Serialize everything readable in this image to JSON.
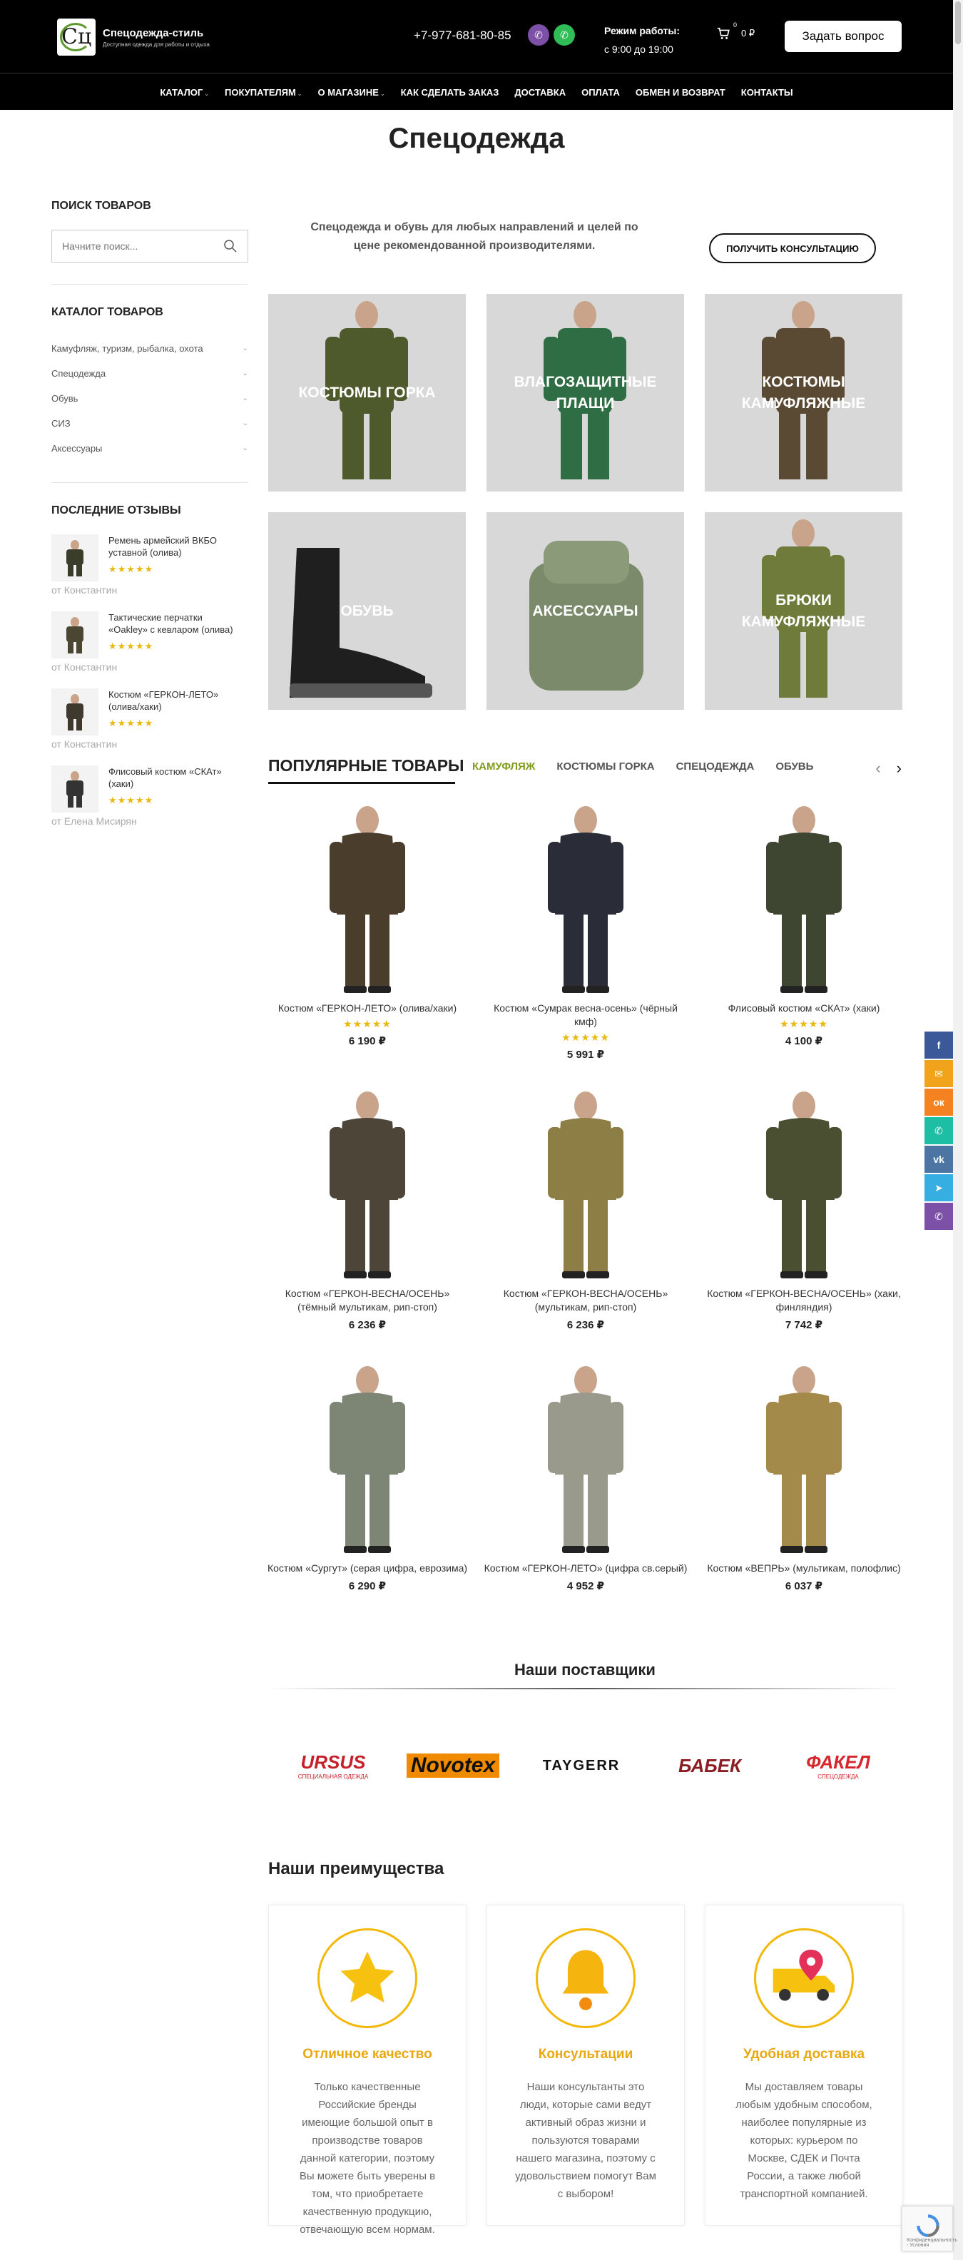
{
  "header": {
    "logo_title": "Спецодежда-стиль",
    "logo_subtitle": "Доступная одежда для работы и отдыха",
    "logo_mark": "Сц",
    "phone": "+7-977-681-80-85",
    "hours_label": "Режим работы:",
    "hours_value": "с 9:00 до 19:00",
    "cart_total": "0 ₽",
    "cart_count": "0",
    "ask_button": "Задать вопрос"
  },
  "nav": [
    {
      "label": "КАТАЛОГ",
      "caret": true
    },
    {
      "label": "ПОКУПАТЕЛЯМ",
      "caret": true
    },
    {
      "label": "О МАГАЗИНЕ",
      "caret": true
    },
    {
      "label": "КАК СДЕЛАТЬ ЗАКАЗ",
      "caret": false
    },
    {
      "label": "ДОСТАВКА",
      "caret": false
    },
    {
      "label": "ОПЛАТА",
      "caret": false
    },
    {
      "label": "ОБМЕН И ВОЗВРАТ",
      "caret": false
    },
    {
      "label": "КОНТАКТЫ",
      "caret": false
    }
  ],
  "page_title": "Спецодежда",
  "sidebar": {
    "search_heading": "ПОИСК ТОВАРОВ",
    "search_placeholder": "Начните поиск...",
    "catalog_heading": "КАТАЛОГ ТОВАРОВ",
    "categories": [
      "Камуфляж, туризм, рыбалка, охота",
      "Спецодежда",
      "Обувь",
      "СИЗ",
      "Аксессуары"
    ],
    "reviews_heading": "ПОСЛЕДНИЕ ОТЗЫВЫ",
    "reviews": [
      {
        "product": "Ремень армейский ВКБО уставной (олива)",
        "author": "от Константин",
        "stars": "★★★★★"
      },
      {
        "product": "Тактические перчатки «Oakley» с кевларом (олива)",
        "author": "от Константин",
        "stars": "★★★★★"
      },
      {
        "product": "Костюм «ГЕРКОН-ЛЕТО» (олива/хаки)",
        "author": "от Константин",
        "stars": "★★★★★"
      },
      {
        "product": "Флисовый костюм «СКАт» (хаки)",
        "author": "от Елена Мисирян",
        "stars": "★★★★★"
      }
    ]
  },
  "intro": {
    "text": "Спецодежда и обувь для любых направлений и целей по цене рекомендованной производителями.",
    "consult_button": "ПОЛУЧИТЬ КОНСУЛЬТАЦИЮ"
  },
  "categories": [
    {
      "label": "КОСТЮМЫ ГОРКА",
      "color": "#4f5a2c"
    },
    {
      "label": "ВЛАГОЗАЩИТНЫЕ ПЛАЩИ",
      "color": "#2f6d45"
    },
    {
      "label": "КОСТЮМЫ КАМУФЛЯЖНЫЕ",
      "color": "#5b4a33"
    },
    {
      "label": "ОБУВЬ",
      "color": "#1f1f1f"
    },
    {
      "label": "АКСЕССУАРЫ",
      "color": "#7a8a6a"
    },
    {
      "label": "БРЮКИ КАМУФЛЯЖНЫЕ",
      "color": "#6f7b3a"
    }
  ],
  "popular": {
    "title": "ПОПУЛЯРНЫЕ ТОВАРЫ",
    "tabs": [
      "КАМУФЛЯЖ",
      "КОСТЮМЫ ГОРКА",
      "СПЕЦОДЕЖДА",
      "ОБУВЬ"
    ],
    "products": [
      {
        "name": "Костюм «ГЕРКОН-ЛЕТО» (олива/хаки)",
        "price": "6 190 ₽",
        "stars": "★★★★★",
        "color": "#4a3d2c"
      },
      {
        "name": "Костюм «Сумрак весна-осень» (чёрный кмф)",
        "price": "5 991 ₽",
        "stars": "★★★★★",
        "color": "#2a2d38"
      },
      {
        "name": "Флисовый костюм «СКАт» (хаки)",
        "price": "4 100 ₽",
        "stars": "★★★★★",
        "color": "#3e4530"
      },
      {
        "name": "Костюм «ГЕРКОН-ВЕСНА/ОСЕНЬ» (тёмный мультикам, рип-стоп)",
        "price": "6 236 ₽",
        "stars": "",
        "color": "#4c4538"
      },
      {
        "name": "Костюм «ГЕРКОН-ВЕСНА/ОСЕНЬ» (мультикам, рип-стоп)",
        "price": "6 236 ₽",
        "stars": "",
        "color": "#8c7e44"
      },
      {
        "name": "Костюм «ГЕРКОН-ВЕСНА/ОСЕНЬ» (хаки, финляндия)",
        "price": "7 742 ₽",
        "stars": "",
        "color": "#4a4f32"
      },
      {
        "name": "Костюм «Сургут» (серая цифра, еврозима)",
        "price": "6 290 ₽",
        "stars": "",
        "color": "#7d8575"
      },
      {
        "name": "Костюм «ГЕРКОН-ЛЕТО» (цифра св.серый)",
        "price": "4 952 ₽",
        "stars": "",
        "color": "#9a9a8c"
      },
      {
        "name": "Костюм «ВЕПРЬ» (мультикам, полофлис)",
        "price": "6 037 ₽",
        "stars": "",
        "color": "#a48a4a"
      }
    ]
  },
  "suppliers": {
    "title": "Наши поставщики",
    "brands": [
      {
        "name": "URSUS",
        "sub": "СПЕЦИАЛЬНАЯ ОДЕЖДА",
        "color": "#c8202a"
      },
      {
        "name": "Novotex",
        "sub": "",
        "color": "#f08a00"
      },
      {
        "name": "TAYGERR",
        "sub": "",
        "color": "#111111"
      },
      {
        "name": "БАБЕК",
        "sub": "",
        "color": "#8a1e22"
      },
      {
        "name": "ФАКЕЛ",
        "sub": "СПЕЦОДЕЖДА",
        "color": "#d6262e"
      }
    ]
  },
  "advantages": {
    "title": "Наши преимущества",
    "items": [
      {
        "heading": "Отличное качество",
        "text": "Только качественные Российские бренды имеющие большой опыт в производстве товаров данной категории, поэтому Вы можете быть уверены в том, что приобретаете качественную продукцию, отвечающую всем нормам.",
        "icon": "star-icon"
      },
      {
        "heading": "Консультации",
        "text": "Наши консультанты это люди, которые сами ведут активный образ жизни и пользуются товарами нашего магазина, поэтому с удовольствием помогут Вам с выбором!",
        "icon": "bell-icon"
      },
      {
        "heading": "Удобная доставка",
        "text": "Мы доставляем товары любым удобным способом, наиболее популярные из которых: курьером по Москве, СДЕК и Почта России, а также любой транспортной компанией.",
        "icon": "truck-icon"
      }
    ]
  },
  "share": [
    {
      "icon": "facebook-icon",
      "glyph": "f",
      "color": "#3b5998"
    },
    {
      "icon": "email-icon",
      "glyph": "✉",
      "color": "#f2a31c"
    },
    {
      "icon": "odnoklassniki-icon",
      "glyph": "ок",
      "color": "#f58220"
    },
    {
      "icon": "whatsapp-icon",
      "glyph": "✆",
      "color": "#1ebea5"
    },
    {
      "icon": "vk-icon",
      "glyph": "vk",
      "color": "#4c75a3"
    },
    {
      "icon": "telegram-icon",
      "glyph": "➤",
      "color": "#37aee2"
    },
    {
      "icon": "viber-icon",
      "glyph": "✆",
      "color": "#7d50a8"
    }
  ],
  "recaptcha_text": "Конфиденциальность - Условия"
}
